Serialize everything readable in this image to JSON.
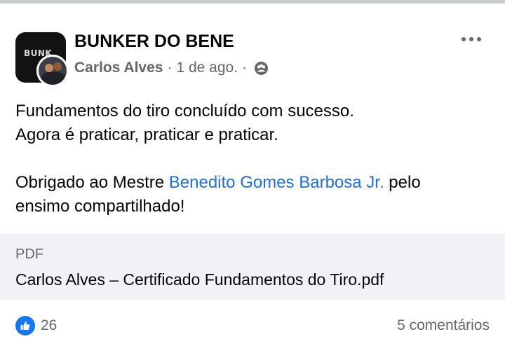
{
  "post": {
    "group_name": "BUNKER DO BENE",
    "group_avatar_text": "BUNK",
    "author": "Carlos Alves",
    "separator": "·",
    "timestamp": "1 de ago.",
    "privacy_icon": "group-members-icon",
    "more_icon": "more-options-icon",
    "text": {
      "line1": "Fundamentos do tiro concluído com sucesso.",
      "line2": "Agora é praticar, praticar e praticar.",
      "line3_before": "Obrigado ao Mestre ",
      "mention": "Benedito Gomes Barbosa Jr.",
      "line3_after": " pelo",
      "line4": "ensimo compartilhado!"
    }
  },
  "attachment": {
    "type": "PDF",
    "name": "Carlos Alves – Certificado Fundamentos do Tiro.pdf"
  },
  "footer": {
    "reaction_icon": "like-icon",
    "reaction_count": "26",
    "comments": "5 comentários"
  },
  "colors": {
    "link": "#216fdb",
    "secondary_text": "#65676b",
    "like_blue": "#1877f2",
    "attachment_bg": "#f0f2f5"
  }
}
